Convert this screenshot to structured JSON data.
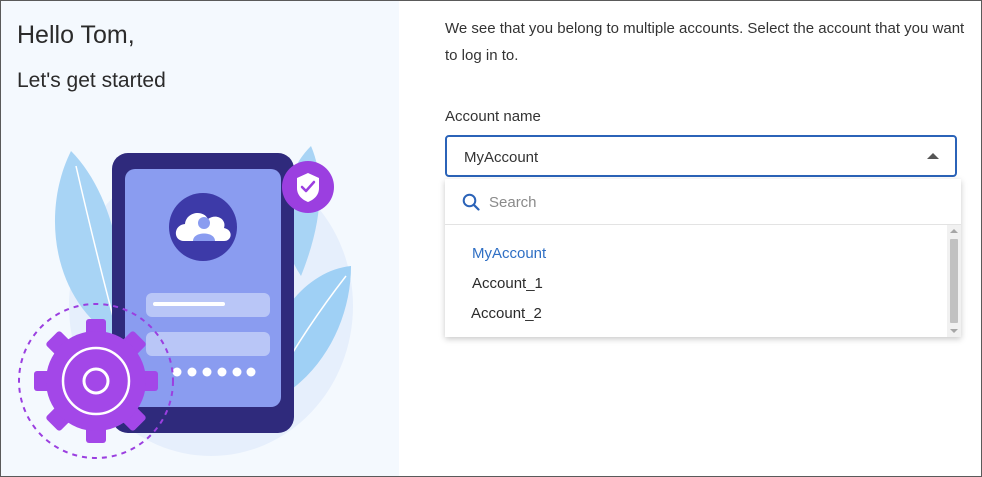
{
  "greeting": {
    "title": "Hello Tom,",
    "subtitle": "Let's get started"
  },
  "intro_text": "We see that you belong to multiple accounts. Select the account that you want to log in to.",
  "account_select": {
    "label": "Account name",
    "value": "MyAccount"
  },
  "dropdown": {
    "search_placeholder": "Search",
    "options": [
      "MyAccount",
      "Account_1",
      "Account_2"
    ],
    "selected_option": "MyAccount"
  },
  "colors": {
    "accent": "#2b63b8",
    "selected_text": "#2f6fc4",
    "left_panel_bg": "#f4f9fe",
    "phone_dark": "#2f2a7c",
    "gear_purple": "#9b3fe0"
  },
  "icons": [
    "caret-up-icon",
    "search-icon",
    "cloud-user-icon",
    "shield-check-icon",
    "gear-icon"
  ]
}
